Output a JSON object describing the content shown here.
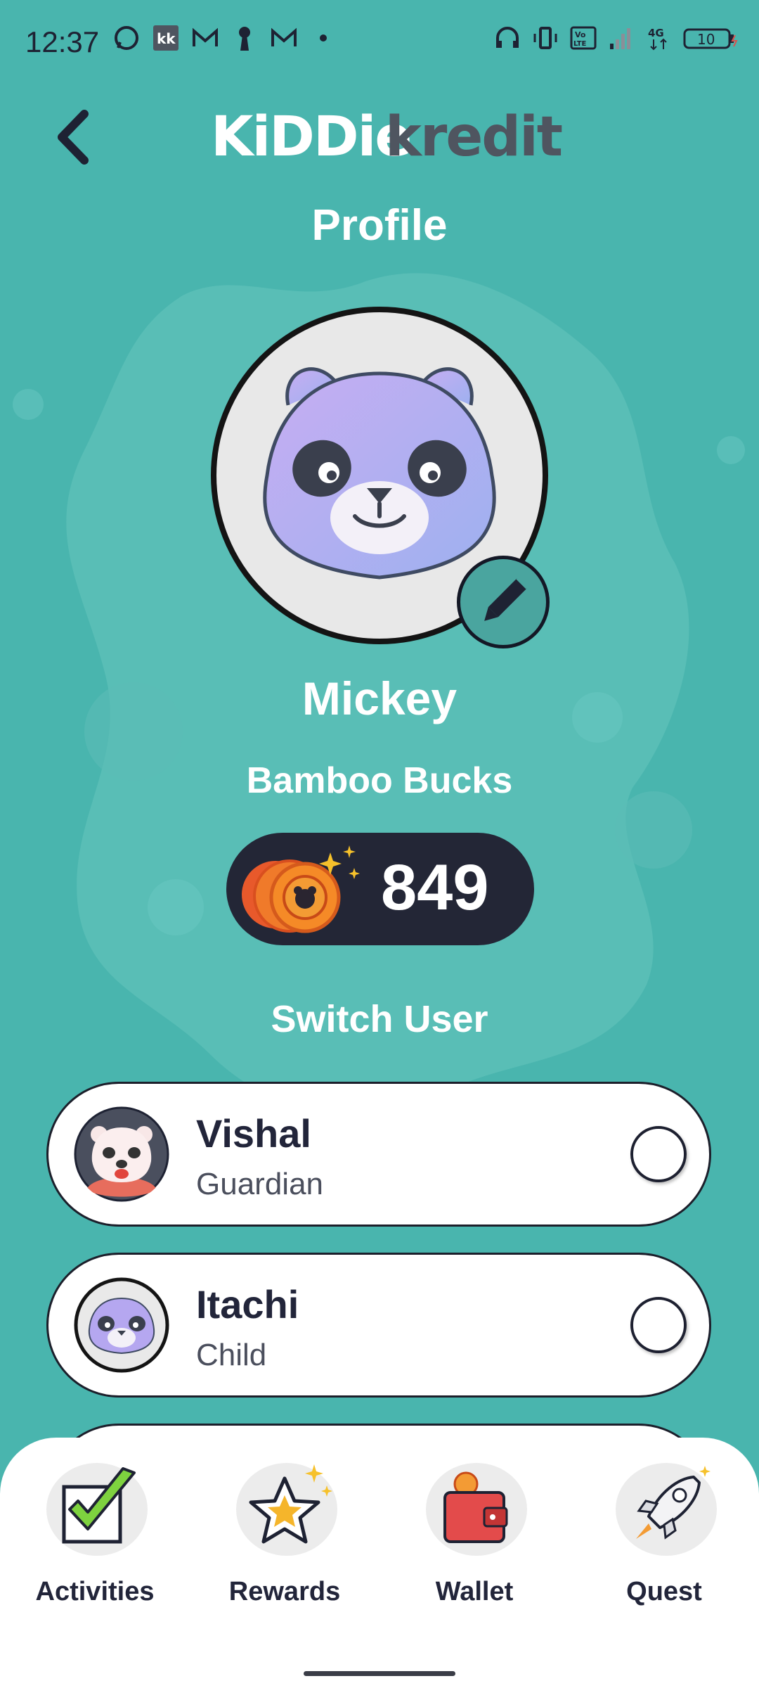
{
  "status_bar": {
    "time": "12:37",
    "left_icons": [
      "whatsapp-icon",
      "kk-app-icon",
      "gmail-icon",
      "keyhole-icon",
      "gmail-icon",
      "dot-icon"
    ],
    "right_icons": [
      "headset-icon",
      "vibrate-icon",
      "volte-icon",
      "signal-icon",
      "4g-icon",
      "battery-icon"
    ],
    "battery": "10"
  },
  "header": {
    "back_icon": "chevron-left-icon",
    "logo_part1": "KiDDie",
    "logo_part2": "kredit",
    "title": "Profile"
  },
  "profile": {
    "name": "Mickey",
    "avatar_icon": "purple-panda-avatar",
    "edit_icon": "pencil-icon",
    "bucks_label": "Bamboo Bucks",
    "bucks_value": "849",
    "coin_icon": "bamboo-coins-icon"
  },
  "switch_user": {
    "title": "Switch User",
    "users": [
      {
        "name": "Vishal",
        "role": "Guardian",
        "avatar_icon": "polar-bear-avatar"
      },
      {
        "name": "Itachi",
        "role": "Child",
        "avatar_icon": "purple-panda-avatar"
      }
    ]
  },
  "bottom_nav": {
    "items": [
      {
        "label": "Activities",
        "icon": "checkbox-icon"
      },
      {
        "label": "Rewards",
        "icon": "star-icon"
      },
      {
        "label": "Wallet",
        "icon": "wallet-icon"
      },
      {
        "label": "Quest",
        "icon": "rocket-icon"
      }
    ]
  },
  "colors": {
    "background": "#49b5ae",
    "dark": "#232636",
    "card": "#ffffff"
  }
}
